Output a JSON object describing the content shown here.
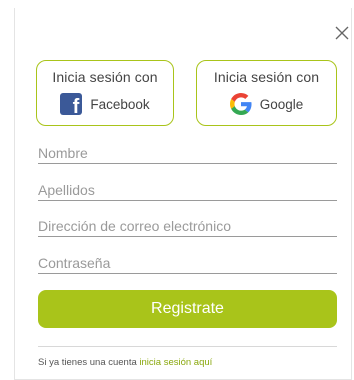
{
  "social": {
    "facebook": {
      "label": "Inicia sesión con",
      "provider": "Facebook",
      "icon": "facebook-icon",
      "color": "#3b5998"
    },
    "google": {
      "label": "Inicia sesión con",
      "provider": "Google",
      "icon": "google-icon"
    }
  },
  "form": {
    "nombre_placeholder": "Nombre",
    "apellidos_placeholder": "Apellidos",
    "email_placeholder": "Dirección de correo electrónico",
    "password_placeholder": "Contraseña",
    "submit_label": "Registrate"
  },
  "footer": {
    "text": "Si ya tienes una cuenta",
    "link": "inicia sesión aquí"
  },
  "colors": {
    "accent": "#a9c41a",
    "link": "#8aa80e",
    "placeholder": "#9a9a9a"
  },
  "icons": {
    "close": "close-icon"
  }
}
